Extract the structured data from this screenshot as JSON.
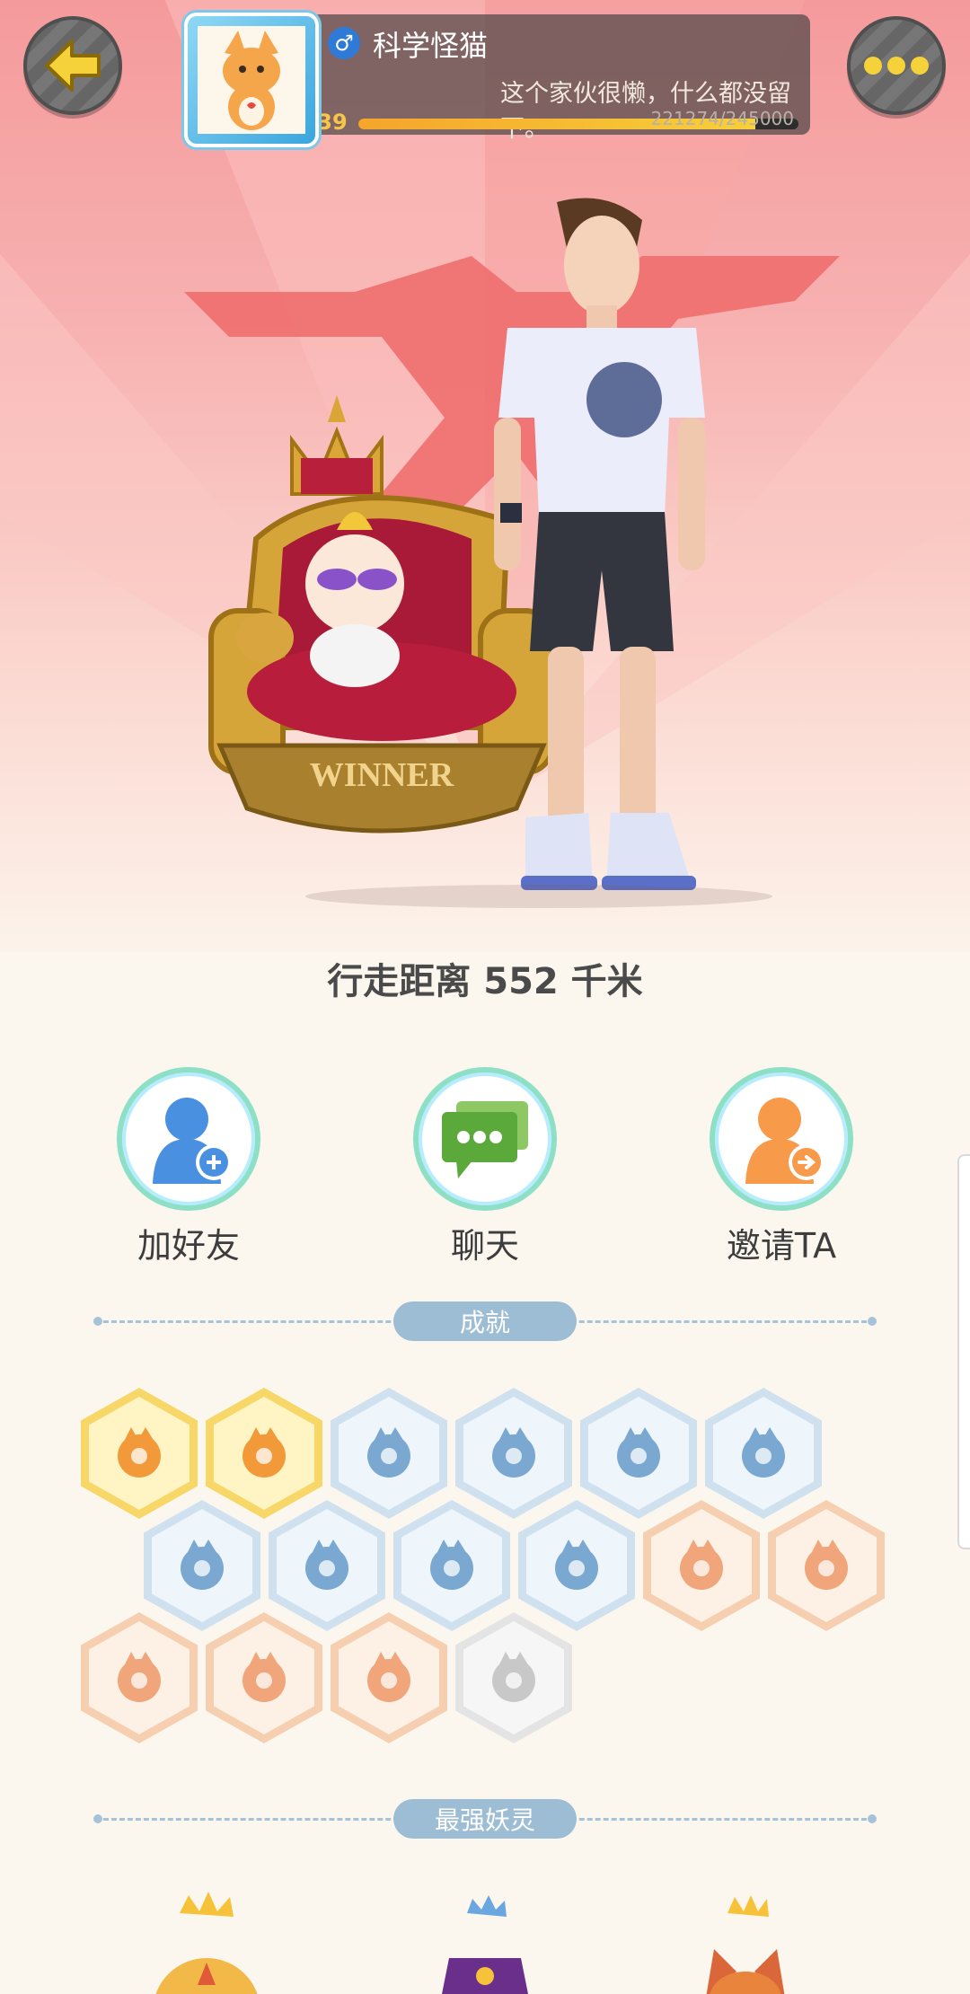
{
  "header": {
    "back_icon": "arrow-left-icon",
    "more_icon": "more-dots-icon"
  },
  "profile": {
    "nickname": "科学怪猫",
    "gender_icon": "male-icon",
    "gender_symbol": "♂",
    "bio": "这个家伙很懒，什么都没留下。",
    "level": "39",
    "xp_text": "221274/245000",
    "xp_progress": 0.903
  },
  "walk_distance": "行走距离 552 千米",
  "actions": [
    {
      "label": "加好友",
      "icon": "add-friend-icon"
    },
    {
      "label": "聊天",
      "icon": "chat-icon"
    },
    {
      "label": "邀请TA",
      "icon": "invite-icon"
    }
  ],
  "sections": {
    "achievements": "成就",
    "strongest_spirit": "最强妖灵"
  },
  "badges": [
    {
      "icon": "cat-moon-badge-icon",
      "tier": "gold"
    },
    {
      "icon": "yinyang-comet-badge-icon",
      "tier": "gold"
    },
    {
      "icon": "sneaker-badge-icon",
      "tier": "blue"
    },
    {
      "icon": "portal-badge-icon",
      "tier": "blue"
    },
    {
      "icon": "moon-phase-badge-icon",
      "tier": "blue"
    },
    {
      "icon": "orb-badge-icon",
      "tier": "blue"
    },
    {
      "icon": "crystal-badge-icon",
      "tier": "blue"
    },
    {
      "icon": "fox-spirit-badge-icon",
      "tier": "blue"
    },
    {
      "icon": "yinyang-scroll-badge-icon",
      "tier": "blue"
    },
    {
      "icon": "dragon-wave-badge-icon",
      "tier": "blue"
    },
    {
      "icon": "monkey-flame-badge-icon",
      "tier": "orange"
    },
    {
      "icon": "cat-cart-badge-icon",
      "tier": "orange"
    },
    {
      "icon": "scroll-seal-badge-icon",
      "tier": "orange"
    },
    {
      "icon": "ox-pedestal-badge-icon",
      "tier": "orange"
    },
    {
      "icon": "twin-cats-badge-icon",
      "tier": "orange"
    },
    {
      "icon": "wolf-book-badge-icon",
      "tier": "gray"
    }
  ],
  "colors": {
    "accent_yellow": "#f6d23a",
    "panel_dark": "#504646",
    "divider_blue": "#9dbdd4",
    "action_ring": "#8de0c6"
  },
  "scene": {
    "throne_text": "WINNER"
  }
}
